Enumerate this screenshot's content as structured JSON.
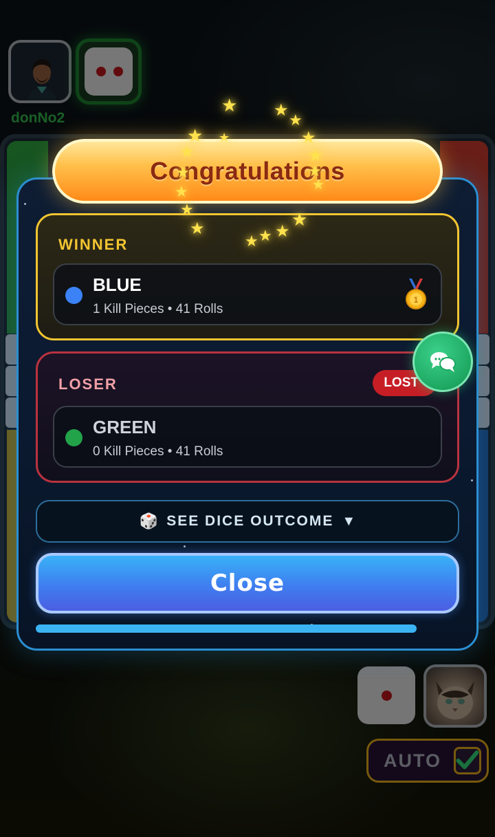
{
  "top_player": {
    "name": "donNo2",
    "dice_value": 2
  },
  "bottom_player": {
    "dice_value": 1
  },
  "auto": {
    "label": "AUTO",
    "checked": true
  },
  "modal": {
    "banner_title": "Congratulations",
    "winner": {
      "heading": "WINNER",
      "player": "BLUE",
      "stats": "1 Kill Pieces • 41 Rolls",
      "color": "#3b82f6"
    },
    "loser": {
      "heading": "LOSER",
      "badge": "LOST",
      "player": "GREEN",
      "stats": "0 Kill Pieces • 41 Rolls",
      "color": "#22a34a"
    },
    "dice_outcome": {
      "icon": "🎲",
      "label": "SEE DICE OUTCOME",
      "arrow": "▼"
    },
    "close_label": "Close",
    "progress": 0.9
  },
  "icons": {
    "chat": "chat-bubbles-icon",
    "medal": "gold-medal-icon",
    "check": "checkmark-icon"
  }
}
